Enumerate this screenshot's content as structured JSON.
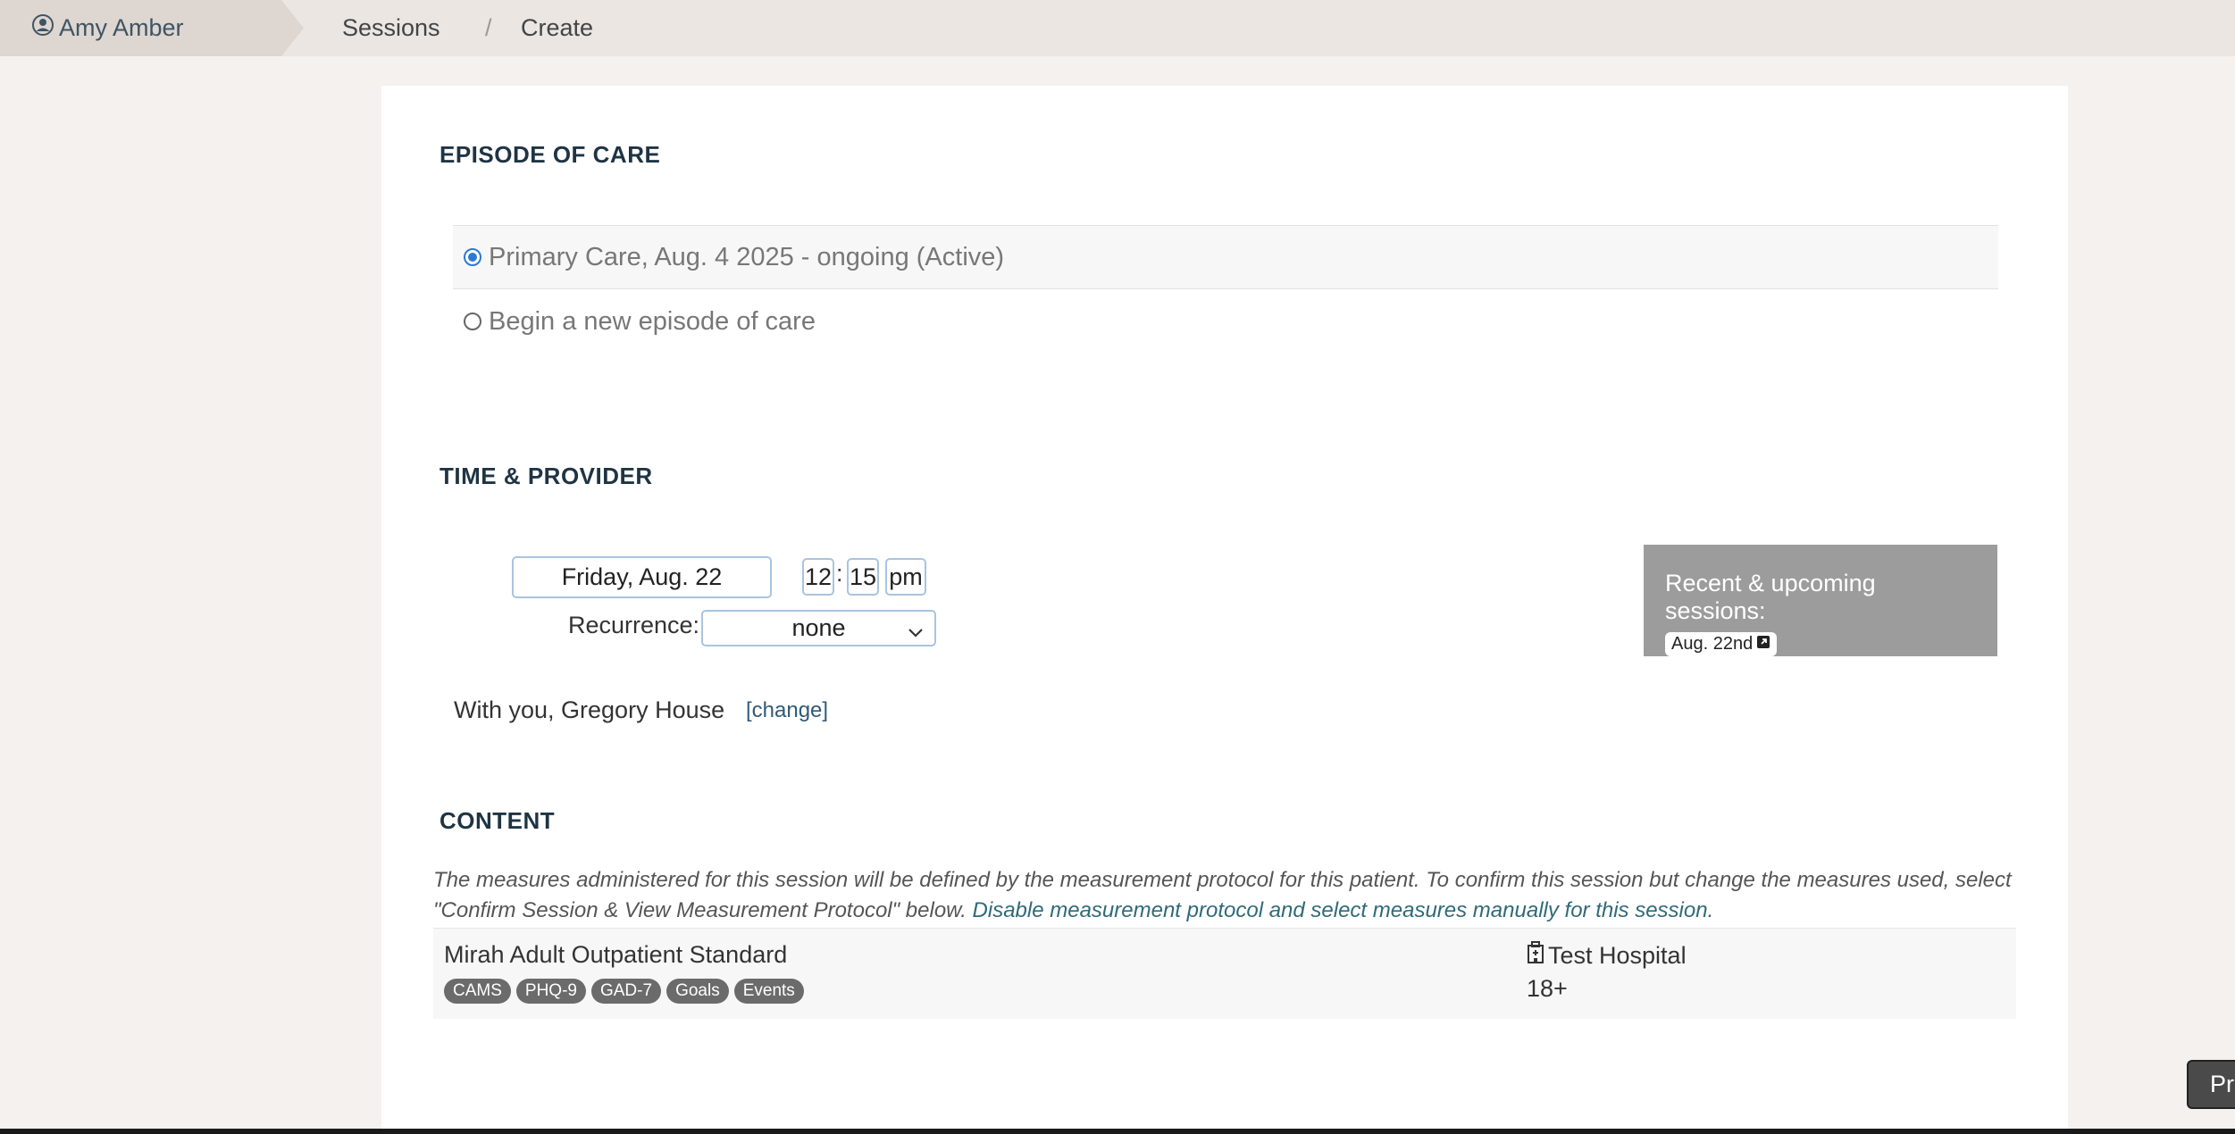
{
  "topbar": {
    "patient_name": "Amy Amber",
    "crumbs": [
      "Sessions",
      "Create"
    ],
    "separator": "/"
  },
  "episode": {
    "heading": "EPISODE OF CARE",
    "options": [
      {
        "label": "Primary Care, Aug. 4 2025 - ongoing (Active)",
        "selected": true
      },
      {
        "label": "Begin a new episode of care",
        "selected": false
      }
    ]
  },
  "time_provider": {
    "heading": "TIME & PROVIDER",
    "date_value": "Friday, Aug. 22",
    "hour": "12",
    "minute": "15",
    "ampm": "pm",
    "colon": ":",
    "recurrence_label": "Recurrence:",
    "recurrence_value": "none",
    "provider_text": "With you, Gregory House",
    "change_link": "[change]",
    "recent_title": "Recent & upcoming sessions:",
    "recent_sessions": [
      "Aug. 22nd"
    ]
  },
  "content": {
    "heading": "CONTENT",
    "description": "The measures administered for this session will be defined by the measurement protocol for this patient. To confirm this session but change the measures used, select \"Confirm Session & View Measurement Protocol\" below.",
    "manual_link": "Disable measurement protocol and select measures manually for this session.",
    "protocol": {
      "name": "Mirah Adult Outpatient Standard",
      "tags": [
        "CAMS",
        "PHQ-9",
        "GAD-7",
        "Goals",
        "Events"
      ],
      "organization": "Test Hospital",
      "age_range": "18+"
    }
  },
  "floating_button": "Pr",
  "colors": {
    "accent_link": "#2f5a78",
    "heading": "#1f3443",
    "radio_selected": "#2f78d4",
    "input_border": "#a9c4df",
    "tag_bg": "#6b6b6b",
    "recent_box_bg": "#9c9c9c"
  },
  "icons": [
    "user-circle-icon",
    "chevron-down-icon",
    "external-link-icon",
    "hospital-icon"
  ]
}
